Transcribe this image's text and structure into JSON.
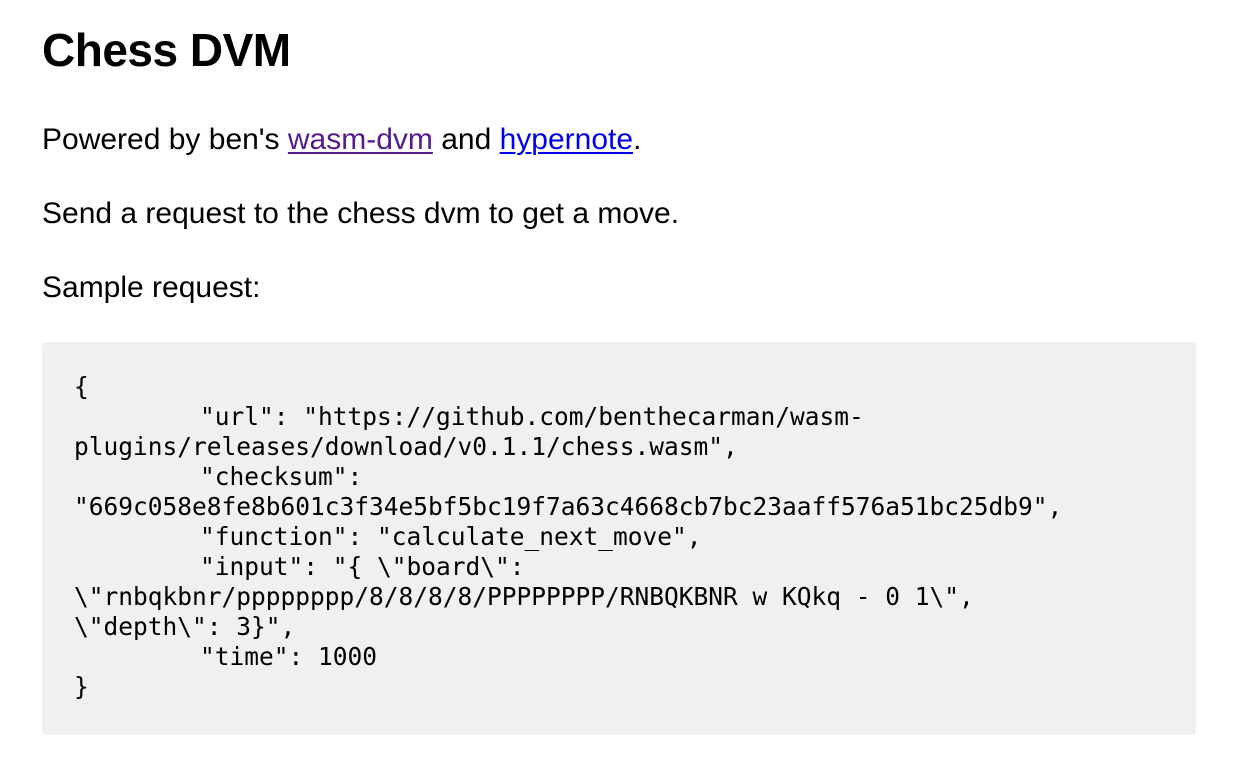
{
  "page": {
    "title": "Chess DVM",
    "intro": {
      "prefix": "Powered by ben's ",
      "link1": "wasm-dvm",
      "middle": " and ",
      "link2": "hypernote",
      "suffix": "."
    },
    "instruction": "Send a request to the chess dvm to get a move.",
    "sample_label": "Sample request:"
  },
  "code": {
    "lines": [
      "{",
      "\"url\": \"https://github.com/benthecarman/wasm-",
      "plugins/releases/download/v0.1.1/chess.wasm\",",
      "\"checksum\":",
      "\"669c058e8fe8b601c3f34e5bf5bc19f7a63c4668cb7bc23aaff576a51bc25db9\",",
      "\"function\": \"calculate_next_move\",",
      "\"input\": \"{ \\\"board\\\":",
      "\\\"rnbqkbnr/pppppppp/8/8/8/8/PPPPPPPP/RNBQKBNR w KQkq - 0 1\\\",",
      "\\\"depth\\\": 3}\",",
      "\"time\": 1000",
      "}"
    ]
  },
  "colors": {
    "visited_link": "#551a8b",
    "unvisited_link": "#0000ee",
    "code_background": "#f0f0f0"
  }
}
